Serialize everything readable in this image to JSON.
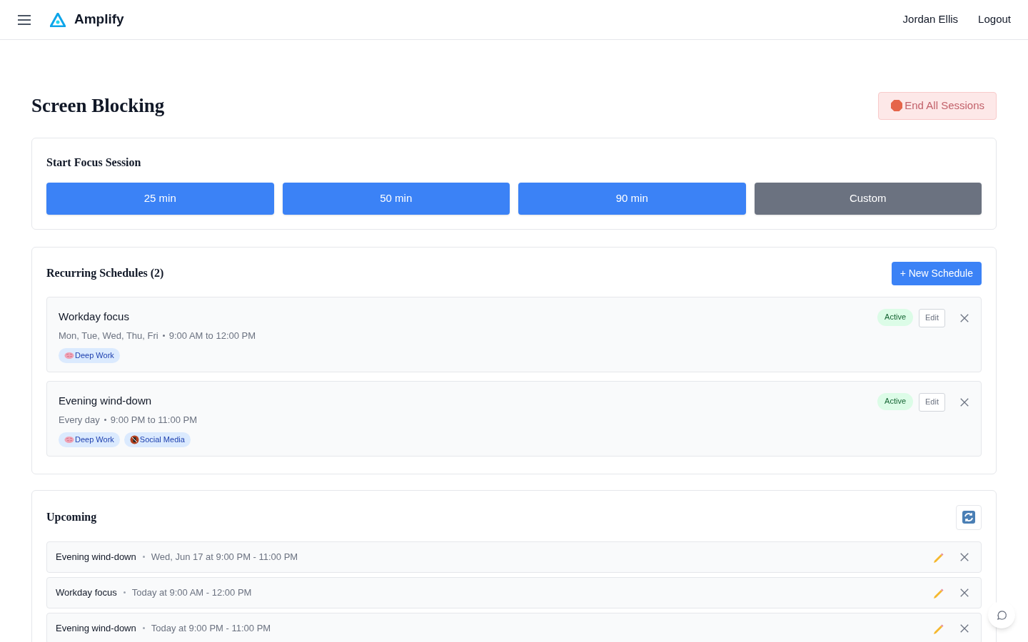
{
  "header": {
    "brand": "Amplify",
    "user": "Jordan Ellis",
    "logout": "Logout"
  },
  "page": {
    "title": "Screen Blocking",
    "end_button": "End All Sessions"
  },
  "focus": {
    "title": "Start Focus Session",
    "buttons": [
      {
        "label": "25 min",
        "kind": "preset"
      },
      {
        "label": "50 min",
        "kind": "preset"
      },
      {
        "label": "90 min",
        "kind": "preset"
      },
      {
        "label": "Custom",
        "kind": "custom"
      }
    ]
  },
  "schedules": {
    "title": "Recurring Schedules (2)",
    "new_button": "+ New Schedule",
    "items": [
      {
        "name": "Workday focus",
        "days": "Mon, Tue, Wed, Thu, Fri",
        "time": "9:00 AM to 12:00 PM",
        "status": "Active",
        "edit": "Edit",
        "tags": [
          {
            "label": "Deep Work",
            "kind": "brain"
          }
        ]
      },
      {
        "name": "Evening wind-down",
        "days": "Every day",
        "time": "9:00 PM to 11:00 PM",
        "status": "Active",
        "edit": "Edit",
        "tags": [
          {
            "label": "Deep Work",
            "kind": "brain"
          },
          {
            "label": "Social Media",
            "kind": "no-phone"
          }
        ]
      }
    ]
  },
  "upcoming": {
    "title": "Upcoming",
    "items": [
      {
        "name": "Evening wind-down",
        "when": "Wed, Jun 17 at 9:00 PM - 11:00 PM"
      },
      {
        "name": "Workday focus",
        "when": "Today at 9:00 AM - 12:00 PM"
      },
      {
        "name": "Evening wind-down",
        "when": "Today at 9:00 PM - 11:00 PM"
      }
    ]
  }
}
